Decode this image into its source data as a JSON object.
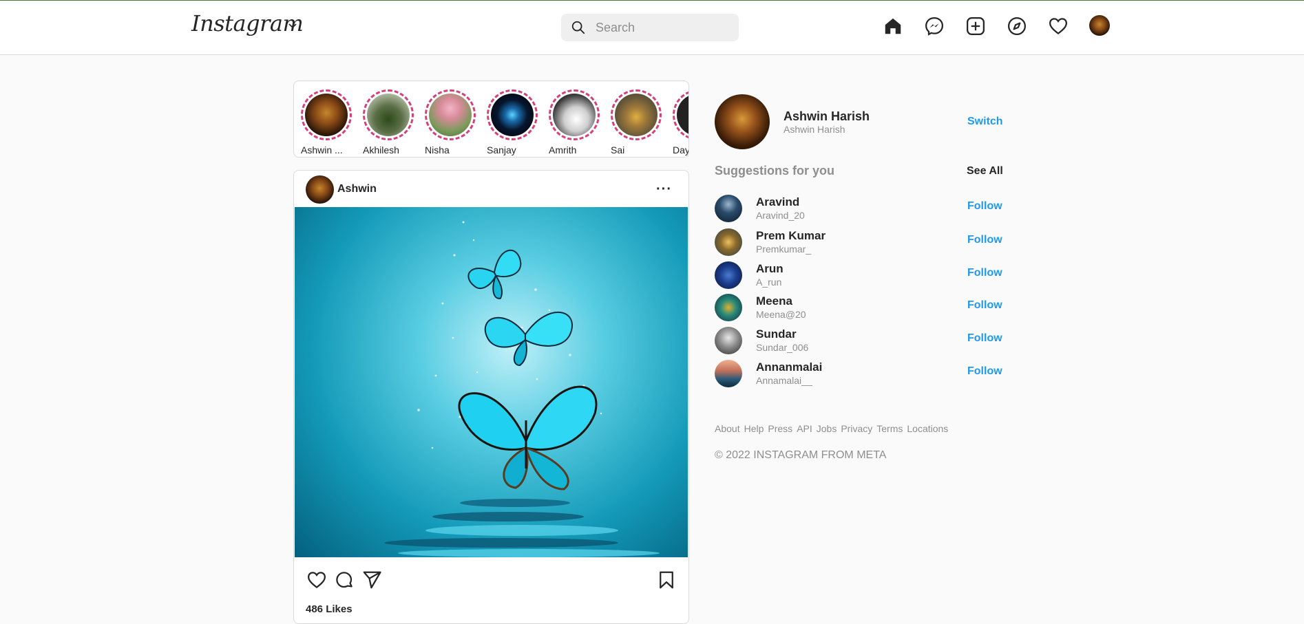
{
  "header": {
    "logo": "Instagram",
    "search_placeholder": "Search",
    "icons": [
      "home-icon",
      "messenger-icon",
      "new-post-icon",
      "explore-icon",
      "activity-heart-icon",
      "profile-avatar"
    ]
  },
  "stories": [
    {
      "name": "Ashwin ...",
      "color": "#5a3510"
    },
    {
      "name": "Akhilesh",
      "color": "#6f7a5a"
    },
    {
      "name": "Nisha",
      "color": "#d89aa8"
    },
    {
      "name": "Sanjay",
      "color": "#0a1e3a"
    },
    {
      "name": "Amrith",
      "color": "#d8d8d8"
    },
    {
      "name": "Sai",
      "color": "#a98a5a"
    },
    {
      "name": "Day",
      "color": "#222222"
    }
  ],
  "post": {
    "username": "Ashwin",
    "more_label": "···",
    "likes": "486 Likes"
  },
  "sidebar": {
    "profile": {
      "name": "Ashwin Harish",
      "handle": "Ashwin Harish",
      "switch_label": "Switch"
    },
    "suggestions_title": "Suggestions for you",
    "see_all_label": "See All",
    "suggestions": [
      {
        "name": "Aravind",
        "handle": "Aravind_20",
        "follow": "Follow",
        "color": "#1d3a5a"
      },
      {
        "name": "Prem Kumar",
        "handle": "Premkumar_",
        "follow": "Follow",
        "color": "#8a6a2a"
      },
      {
        "name": "Arun",
        "handle": "A_run",
        "follow": "Follow",
        "color": "#1a3a8a"
      },
      {
        "name": "Meena",
        "handle": "Meena@20",
        "follow": "Follow",
        "color": "#2a6a5a"
      },
      {
        "name": "Sundar",
        "handle": "Sundar_006",
        "follow": "Follow",
        "color": "#6a6a6a"
      },
      {
        "name": "Annanmalai",
        "handle": "Annamalai__",
        "follow": "Follow",
        "color": "#c07a5a"
      }
    ],
    "footer_links": [
      "About",
      "Help",
      "Press",
      "API",
      "Jobs",
      "Privacy",
      "Terms",
      "Locations"
    ],
    "copyright": "© 2022 INSTAGRAM FROM META"
  },
  "colors": {
    "accent": "#1f9aeb",
    "story_ring": "#d6407a",
    "background": "#fafafa"
  }
}
